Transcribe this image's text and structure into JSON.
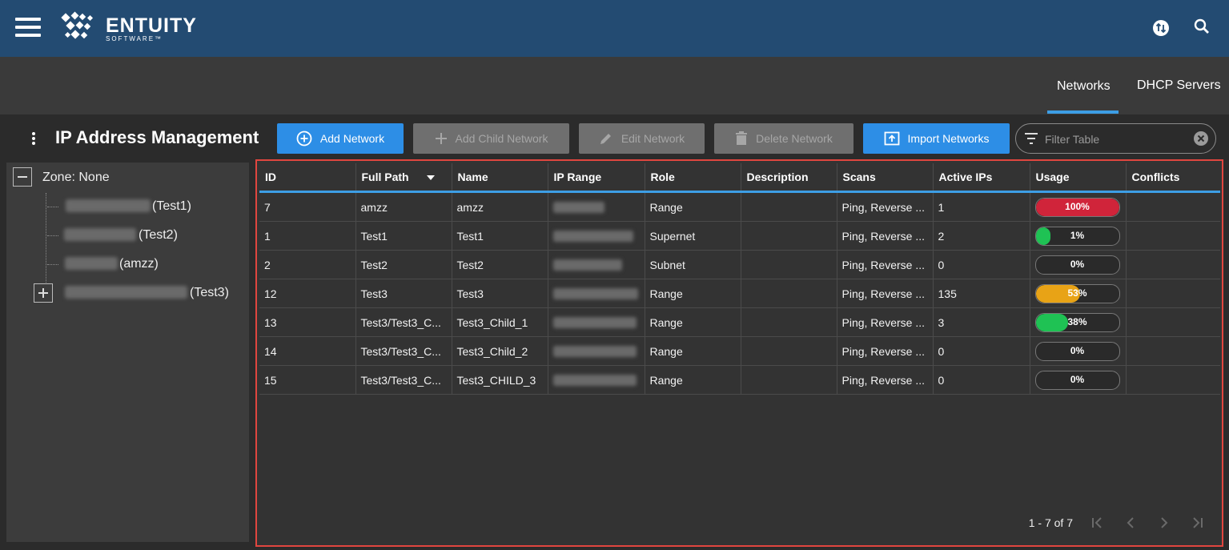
{
  "header": {
    "logo_text": "ENTUITY",
    "logo_sub": "SOFTWARE™",
    "icons": [
      "menu-icon",
      "sync-icon",
      "search-icon"
    ]
  },
  "tabs": [
    {
      "label": "Networks",
      "active": true
    },
    {
      "label": "DHCP Servers",
      "active": false
    }
  ],
  "page_title": "IP Address Management",
  "toolbar": {
    "add_network": "Add Network",
    "add_child_network": "Add Child Network",
    "edit_network": "Edit Network",
    "delete_network": "Delete Network",
    "import_networks": "Import Networks",
    "filter_placeholder": "Filter Table"
  },
  "tree": {
    "root": "Zone: None",
    "items": [
      {
        "label": "(Test1)"
      },
      {
        "label": "(Test2)"
      },
      {
        "label": "(amzz)"
      },
      {
        "label": "(Test3)"
      }
    ]
  },
  "table": {
    "columns": [
      "ID",
      "Full Path",
      "Name",
      "IP Range",
      "Role",
      "Description",
      "Scans",
      "Active IPs",
      "Usage",
      "Conflicts"
    ],
    "rows": [
      {
        "id": "7",
        "path": "amzz",
        "name": "amzz",
        "role": "Range",
        "description": "",
        "scans": "Ping, Reverse ...",
        "active": "1",
        "usage": 100,
        "usage_label": "100%",
        "color": "#d0243a"
      },
      {
        "id": "1",
        "path": "Test1",
        "name": "Test1",
        "role": "Supernet",
        "description": "",
        "scans": "Ping, Reverse ...",
        "active": "2",
        "usage": 1,
        "usage_label": "1%",
        "color": "#1fc254"
      },
      {
        "id": "2",
        "path": "Test2",
        "name": "Test2",
        "role": "Subnet",
        "description": "",
        "scans": "Ping, Reverse ...",
        "active": "0",
        "usage": 0,
        "usage_label": "0%",
        "color": "#1fc254"
      },
      {
        "id": "12",
        "path": "Test3",
        "name": "Test3",
        "role": "Range",
        "description": "",
        "scans": "Ping, Reverse ...",
        "active": "135",
        "usage": 53,
        "usage_label": "53%",
        "color": "#e8a316"
      },
      {
        "id": "13",
        "path": "Test3/Test3_C...",
        "name": "Test3_Child_1",
        "role": "Range",
        "description": "",
        "scans": "Ping, Reverse ...",
        "active": "3",
        "usage": 38,
        "usage_label": "38%",
        "color": "#1fc254"
      },
      {
        "id": "14",
        "path": "Test3/Test3_C...",
        "name": "Test3_Child_2",
        "role": "Range",
        "description": "",
        "scans": "Ping, Reverse ...",
        "active": "0",
        "usage": 0,
        "usage_label": "0%",
        "color": "#1fc254"
      },
      {
        "id": "15",
        "path": "Test3/Test3_C...",
        "name": "Test3_CHILD_3",
        "role": "Range",
        "description": "",
        "scans": "Ping, Reverse ...",
        "active": "0",
        "usage": 0,
        "usage_label": "0%",
        "color": "#1fc254"
      }
    ]
  },
  "pager": {
    "range_text": "1 - 7 of 7"
  }
}
